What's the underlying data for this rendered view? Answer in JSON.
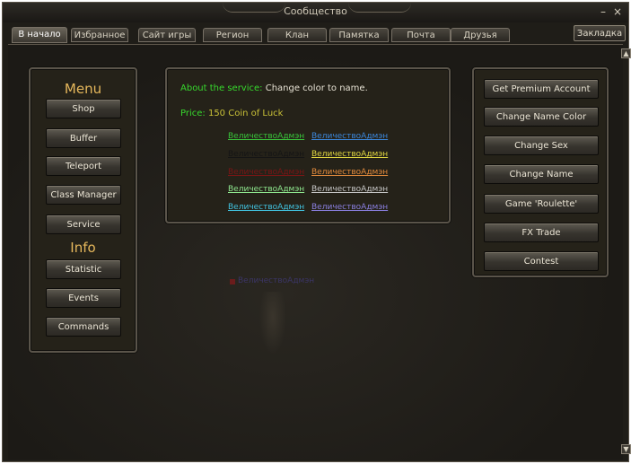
{
  "window": {
    "title": "Сообщество",
    "minimize": "–",
    "close": "×"
  },
  "tabs": [
    "В начало",
    "Избранное",
    "Сайт игры",
    "Регион",
    "Клан",
    "Памятка",
    "Почта",
    "Друзья"
  ],
  "bookmark": "Закладка",
  "left_panel": {
    "menu_heading": "Menu",
    "menu_items": [
      "Shop",
      "Buffer",
      "Teleport",
      "Class Manager",
      "Service"
    ],
    "info_heading": "Info",
    "info_items": [
      "Statistic",
      "Events",
      "Commands"
    ]
  },
  "service": {
    "about_label": "About the service:",
    "about_value": "Change color to name.",
    "price_label": "Price:",
    "price_value": "150 Coin of Luck",
    "name_text": "ВеличествоАдмэн",
    "colors": [
      "#39c33a",
      "#3b86d9",
      "#151515",
      "#e0d640",
      "#7a1515",
      "#e28a3c",
      "#8fe88f",
      "#c6c6c6",
      "#41c3e0",
      "#8a7fe0"
    ],
    "faint_text": "ВеличествоАдмэн"
  },
  "right_panel": {
    "buttons": [
      "Get Premium Account",
      "Change Name Color",
      "Change Sex",
      "Change Name",
      "Game 'Roulette'",
      "FX Trade",
      "Contest"
    ]
  },
  "scroll": {
    "up": "▲",
    "down": "▼"
  }
}
